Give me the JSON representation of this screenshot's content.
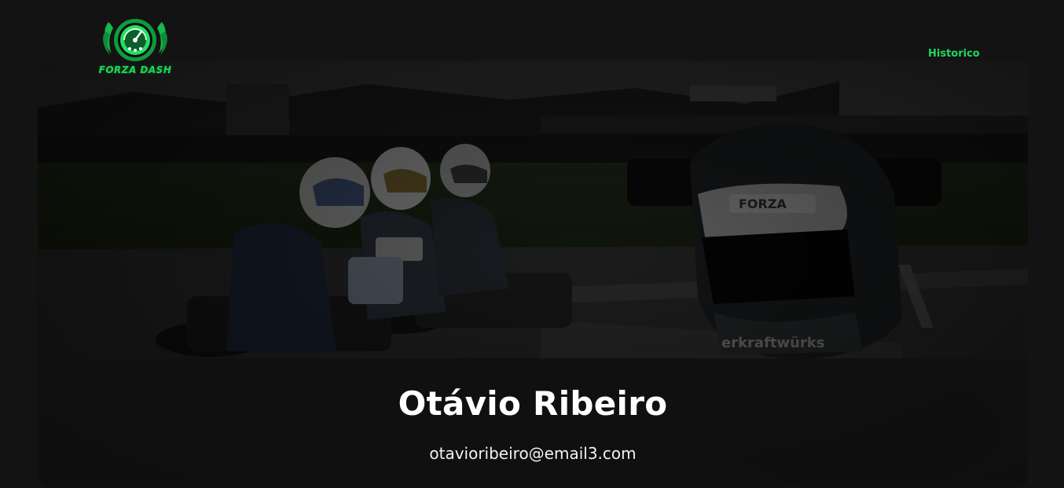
{
  "header": {
    "logo": {
      "icon": "speedometer-emblem-icon",
      "text": "FORZA DASH",
      "color": "#1fd65f"
    },
    "nav": {
      "historico_label": "Historico"
    }
  },
  "profile": {
    "name": "Otávio Ribeiro",
    "email": "otavioribeiro@email3.com",
    "cover_image": "karting-drivers-helmet-photo"
  },
  "colors": {
    "background": "#131313",
    "accent": "#1fd65f",
    "text": "#ffffff"
  }
}
